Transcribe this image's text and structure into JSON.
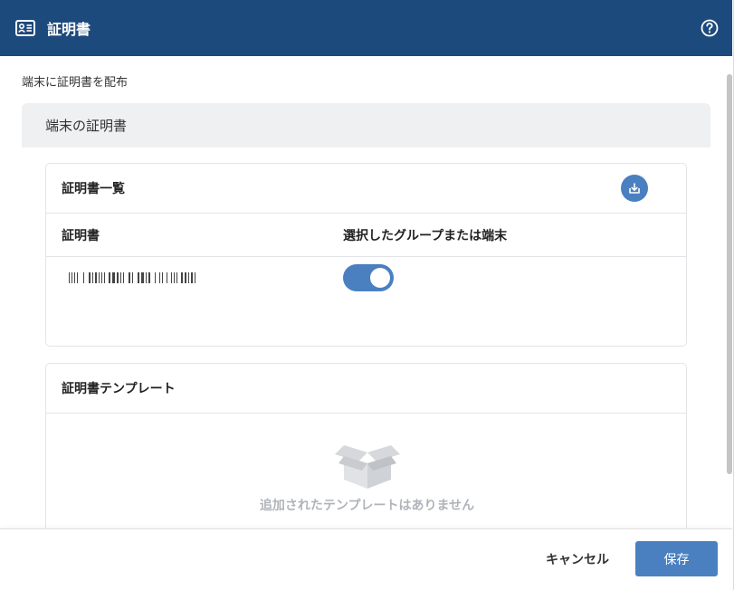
{
  "window": {
    "title": "証明書",
    "title_icon": "id-card-icon",
    "help_icon": "help-circle-icon"
  },
  "page": {
    "subtitle": "端末に証明書を配布"
  },
  "device_certs": {
    "header": "端末の証明書",
    "cert_list": {
      "title": "証明書一覧",
      "download_icon": "download-icon",
      "columns": [
        "証明書",
        "選択したグループまたは端末"
      ],
      "rows": [
        {
          "name_redacted": true,
          "assigned": true
        }
      ]
    },
    "templates": {
      "title": "証明書テンプレート",
      "empty_icon": "empty-box-icon",
      "empty_text": "追加されたテンプレートはありません"
    }
  },
  "footer": {
    "cancel_label": "キャンセル",
    "save_label": "保存"
  },
  "colors": {
    "titlebar": "#1d4a7c",
    "accent": "#4a80c0",
    "panel_header": "#eef0f2"
  }
}
